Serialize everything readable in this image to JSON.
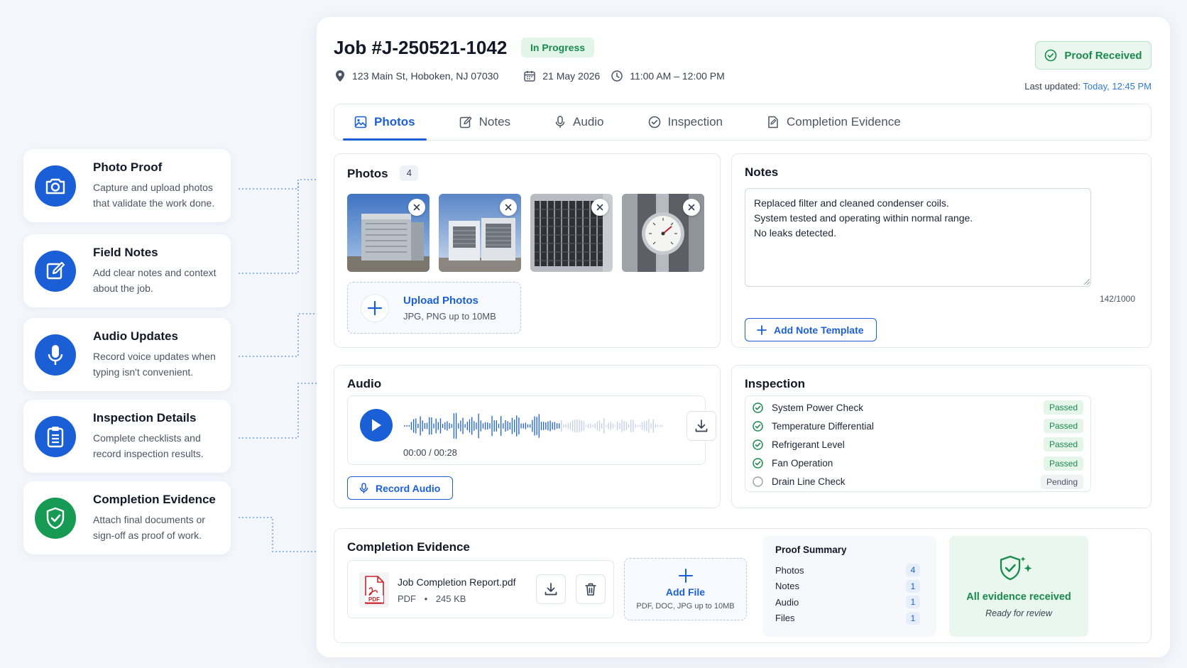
{
  "features": [
    {
      "title": "Photo Proof",
      "desc": "Capture and upload photos that validate the work done.",
      "icon": "camera-icon"
    },
    {
      "title": "Field Notes",
      "desc": "Add clear notes and context about the job.",
      "icon": "edit-note-icon"
    },
    {
      "title": "Audio Updates",
      "desc": "Record voice updates when typing isn't convenient.",
      "icon": "microphone-icon"
    },
    {
      "title": "Inspection Details",
      "desc": "Complete checklists and record inspection results.",
      "icon": "clipboard-icon"
    },
    {
      "title": "Completion Evidence",
      "desc": "Attach final documents or sign-off as proof of work.",
      "icon": "shield-check-icon"
    }
  ],
  "job": {
    "title": "Job #J-250521-1042",
    "status": "In Progress",
    "address": "123 Main St, Hoboken, NJ 07030",
    "date": "21 May 2026",
    "time": "11:00 AM – 12:00 PM",
    "proof_status": "Proof Received",
    "last_updated_label": "Last updated:",
    "last_updated_value": "Today, 12:45 PM"
  },
  "tabs": [
    {
      "label": "Photos",
      "icon": "image-icon",
      "active": true
    },
    {
      "label": "Notes",
      "icon": "edit-icon",
      "active": false
    },
    {
      "label": "Audio",
      "icon": "microphone-icon",
      "active": false
    },
    {
      "label": "Inspection",
      "icon": "check-circle-icon",
      "active": false
    },
    {
      "label": "Completion Evidence",
      "icon": "document-edit-icon",
      "active": false
    }
  ],
  "photos": {
    "title": "Photos",
    "count": "4",
    "upload_title": "Upload Photos",
    "upload_sub": "JPG, PNG up to 10MB"
  },
  "notes": {
    "title": "Notes",
    "text": "Replaced filter and cleaned condenser coils.\nSystem tested and operating within normal range.\nNo leaks detected.",
    "char_count": "142/1000",
    "template_button": "Add Note Template"
  },
  "audio": {
    "title": "Audio",
    "time": "00:00 / 00:28",
    "progress": 0,
    "record_button": "Record Audio"
  },
  "inspection": {
    "title": "Inspection",
    "items": [
      {
        "label": "System Power Check",
        "status": "Passed"
      },
      {
        "label": "Temperature Differential",
        "status": "Passed"
      },
      {
        "label": "Refrigerant Level",
        "status": "Passed"
      },
      {
        "label": "Fan Operation",
        "status": "Passed"
      },
      {
        "label": "Drain Line Check",
        "status": "Pending"
      }
    ]
  },
  "completion": {
    "title": "Completion Evidence",
    "file_name": "Job Completion Report.pdf",
    "file_type": "PDF",
    "file_size": "245 KB",
    "pdf_label": "PDF",
    "add_file_title": "Add File",
    "add_file_sub": "PDF, DOC, JPG up to 10MB",
    "summary_title": "Proof Summary",
    "summary": [
      {
        "label": "Photos",
        "count": "4"
      },
      {
        "label": "Notes",
        "count": "1"
      },
      {
        "label": "Audio",
        "count": "1"
      },
      {
        "label": "Files",
        "count": "1"
      }
    ],
    "all_received_title": "All evidence received",
    "all_received_sub": "Ready for review"
  },
  "colors": {
    "primary": "#1b5fd6",
    "success": "#198a4c",
    "background": "#f3f6fb"
  }
}
